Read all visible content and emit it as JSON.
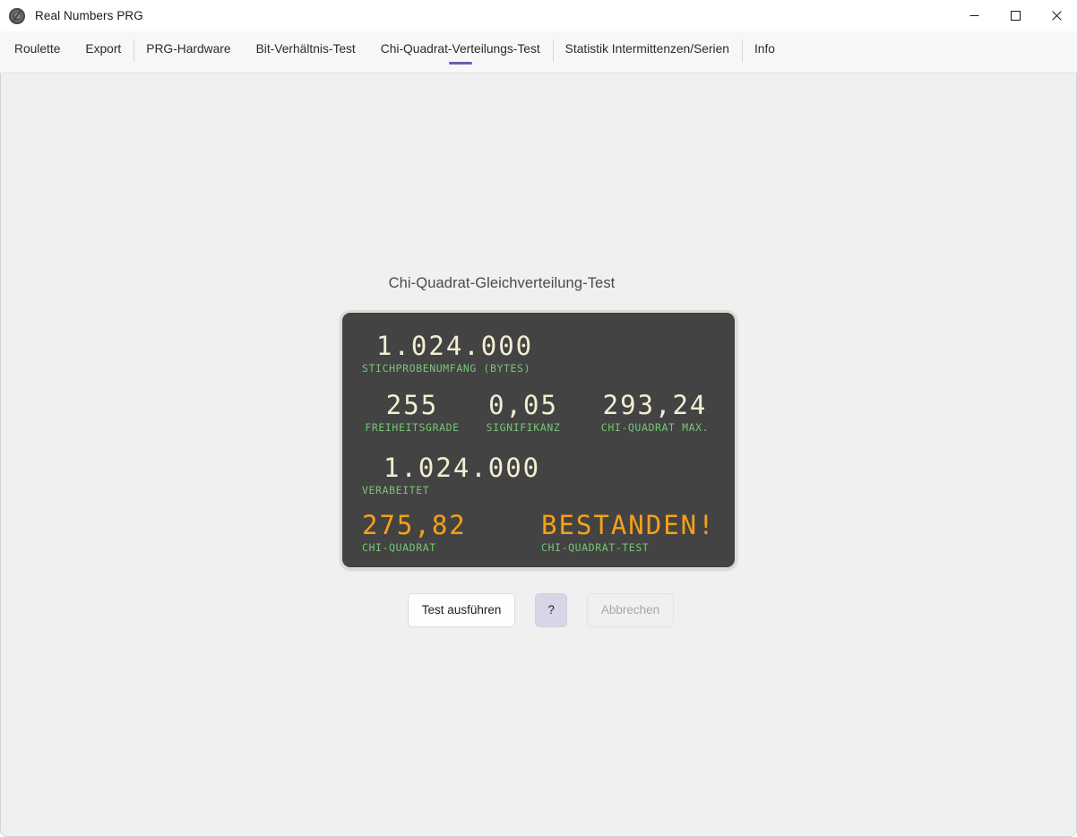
{
  "window": {
    "title": "Real Numbers PRG",
    "icon": "roulette-wheel-icon",
    "controls": {
      "minimize": "minimize-icon",
      "maximize": "maximize-icon",
      "close": "close-icon"
    }
  },
  "menu": {
    "items": [
      {
        "label": "Roulette",
        "active": false,
        "separator_before": false
      },
      {
        "label": "Export",
        "active": false,
        "separator_before": false
      },
      {
        "label": "PRG-Hardware",
        "active": false,
        "separator_before": true
      },
      {
        "label": "Bit-Verhältnis-Test",
        "active": false,
        "separator_before": false
      },
      {
        "label": "Chi-Quadrat-Verteilungs-Test",
        "active": true,
        "separator_before": false
      },
      {
        "label": "Statistik Intermittenzen/Serien",
        "active": false,
        "separator_before": true
      },
      {
        "label": "Info",
        "active": false,
        "separator_before": true
      }
    ],
    "active_indicator_color": "#6b5fab"
  },
  "main": {
    "panel_title": "Chi-Quadrat-Gleichverteilung-Test",
    "display": {
      "colors": {
        "background": "#434343",
        "frame": "#dcdcd2",
        "value": "#f2eed3",
        "label": "#77c478",
        "highlight": "#f5a11b"
      },
      "sample_size": {
        "value": "1.024.000",
        "label": "STICHPROBENUMFANG (BYTES)"
      },
      "degrees_of_freedom": {
        "value": "255",
        "label": "FREIHEITSGRADE"
      },
      "significance": {
        "value": "0,05",
        "label": "SIGNIFIKANZ"
      },
      "chi_square_max": {
        "value": "293,24",
        "label": "CHI-QUADRAT MAX."
      },
      "processed": {
        "value": "1.024.000",
        "label": "VERABEITET"
      },
      "chi_square": {
        "value": "275,82",
        "label": "CHI-QUADRAT"
      },
      "verdict": {
        "value": "BESTANDEN!",
        "label": "CHI-QUADRAT-TEST"
      }
    },
    "buttons": {
      "run": "Test ausführen",
      "help": "?",
      "cancel": "Abbrechen"
    }
  }
}
